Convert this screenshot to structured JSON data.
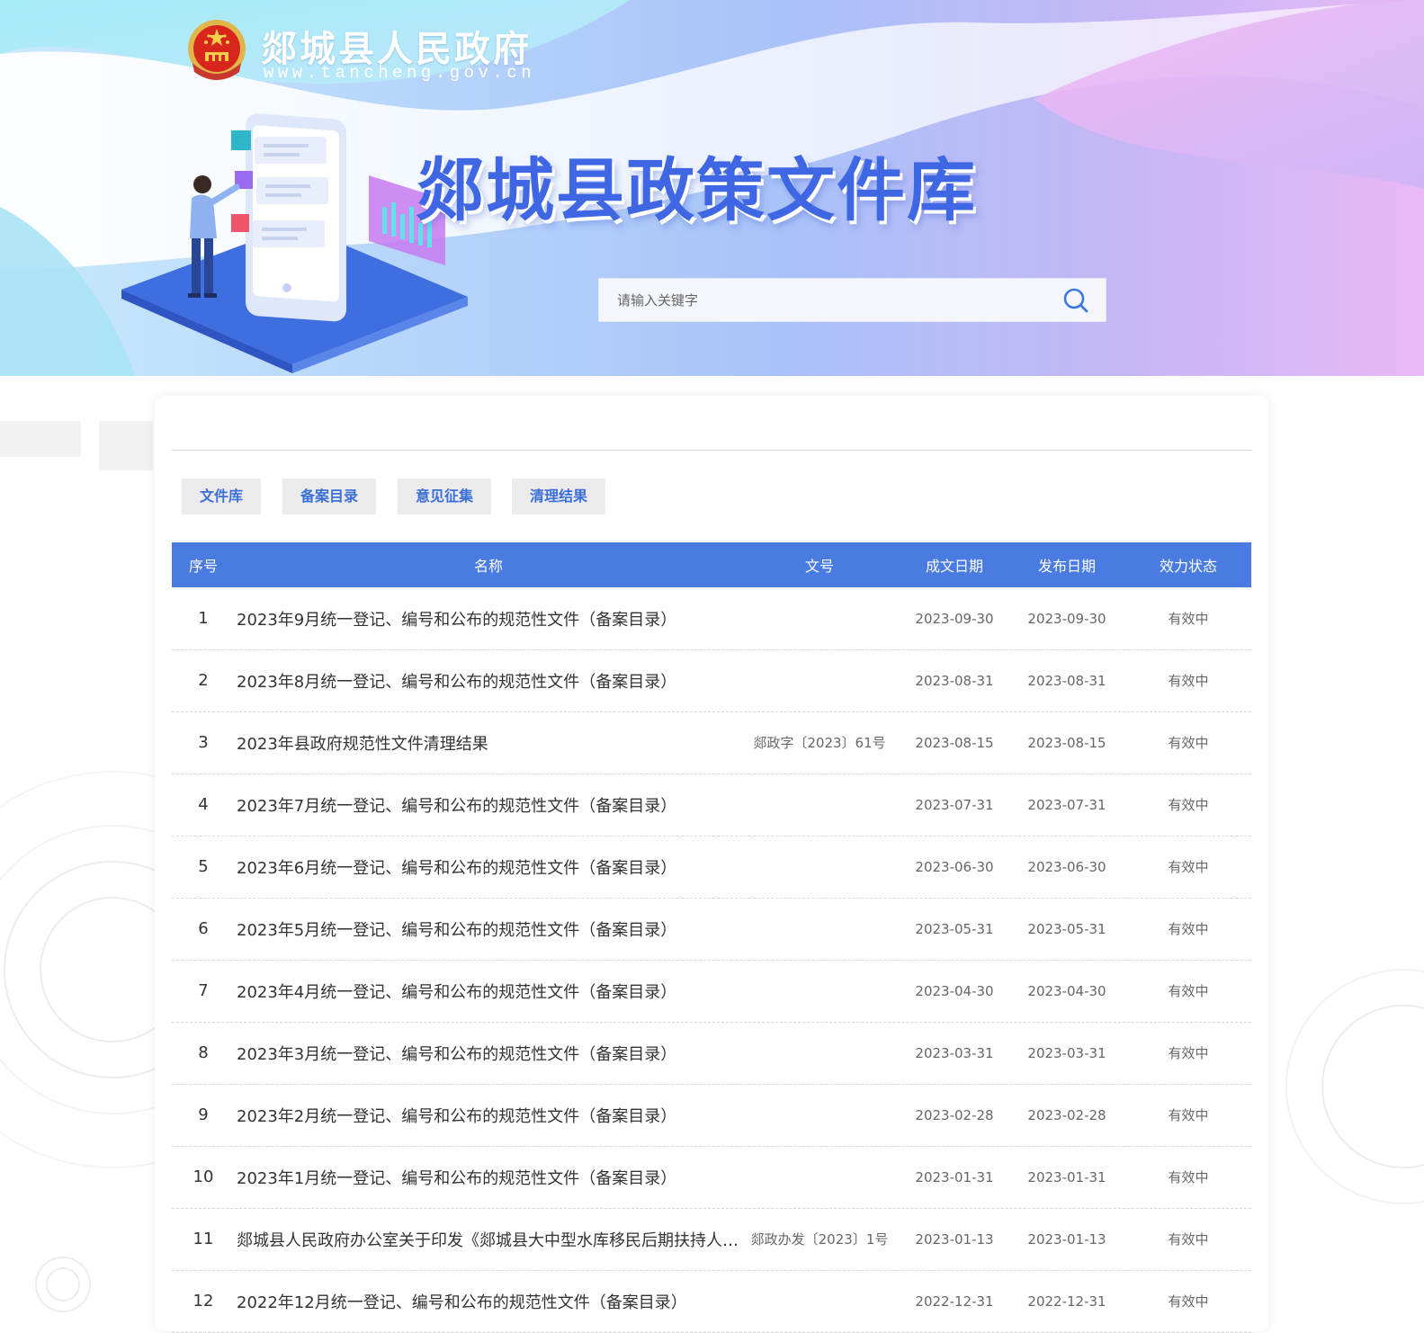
{
  "header": {
    "gov_name": "郯城县人民政府",
    "gov_url": "www.tancheng.gov.cn",
    "title": "郯城县政策文件库"
  },
  "search": {
    "placeholder": "请输入关键字",
    "value": "",
    "icon": "search-icon"
  },
  "tabs": [
    {
      "label": "文件库"
    },
    {
      "label": "备案目录"
    },
    {
      "label": "意见征集"
    },
    {
      "label": "清理结果"
    }
  ],
  "table": {
    "headers": {
      "no": "序号",
      "name": "名称",
      "doc_no": "文号",
      "made_date": "成文日期",
      "pub_date": "发布日期",
      "status": "效力状态"
    },
    "rows": [
      {
        "no": "1",
        "name": "2023年9月统一登记、编号和公布的规范性文件（备案目录）",
        "doc_no": "",
        "made_date": "2023-09-30",
        "pub_date": "2023-09-30",
        "status": "有效中"
      },
      {
        "no": "2",
        "name": "2023年8月统一登记、编号和公布的规范性文件（备案目录）",
        "doc_no": "",
        "made_date": "2023-08-31",
        "pub_date": "2023-08-31",
        "status": "有效中"
      },
      {
        "no": "3",
        "name": "2023年县政府规范性文件清理结果",
        "doc_no": "郯政字〔2023〕61号",
        "made_date": "2023-08-15",
        "pub_date": "2023-08-15",
        "status": "有效中"
      },
      {
        "no": "4",
        "name": "2023年7月统一登记、编号和公布的规范性文件（备案目录）",
        "doc_no": "",
        "made_date": "2023-07-31",
        "pub_date": "2023-07-31",
        "status": "有效中"
      },
      {
        "no": "5",
        "name": "2023年6月统一登记、编号和公布的规范性文件（备案目录）",
        "doc_no": "",
        "made_date": "2023-06-30",
        "pub_date": "2023-06-30",
        "status": "有效中"
      },
      {
        "no": "6",
        "name": "2023年5月统一登记、编号和公布的规范性文件（备案目录）",
        "doc_no": "",
        "made_date": "2023-05-31",
        "pub_date": "2023-05-31",
        "status": "有效中"
      },
      {
        "no": "7",
        "name": "2023年4月统一登记、编号和公布的规范性文件（备案目录）",
        "doc_no": "",
        "made_date": "2023-04-30",
        "pub_date": "2023-04-30",
        "status": "有效中"
      },
      {
        "no": "8",
        "name": "2023年3月统一登记、编号和公布的规范性文件（备案目录）",
        "doc_no": "",
        "made_date": "2023-03-31",
        "pub_date": "2023-03-31",
        "status": "有效中"
      },
      {
        "no": "9",
        "name": "2023年2月统一登记、编号和公布的规范性文件（备案目录）",
        "doc_no": "",
        "made_date": "2023-02-28",
        "pub_date": "2023-02-28",
        "status": "有效中"
      },
      {
        "no": "10",
        "name": "2023年1月统一登记、编号和公布的规范性文件（备案目录）",
        "doc_no": "",
        "made_date": "2023-01-31",
        "pub_date": "2023-01-31",
        "status": "有效中"
      },
      {
        "no": "11",
        "name": "郯城县人民政府办公室关于印发《郯城县大中型水库移民后期扶持人 ...",
        "doc_no": "郯政办发〔2023〕1号",
        "made_date": "2023-01-13",
        "pub_date": "2023-01-13",
        "status": "有效中"
      },
      {
        "no": "12",
        "name": "2022年12月统一登记、编号和公布的规范性文件（备案目录）",
        "doc_no": "",
        "made_date": "2022-12-31",
        "pub_date": "2022-12-31",
        "status": "有效中"
      }
    ]
  },
  "colors": {
    "accent": "#4a7be0",
    "title_blue": "#3f66e3",
    "tab_text": "#3b6fd8",
    "tab_bg": "#ebebeb"
  }
}
